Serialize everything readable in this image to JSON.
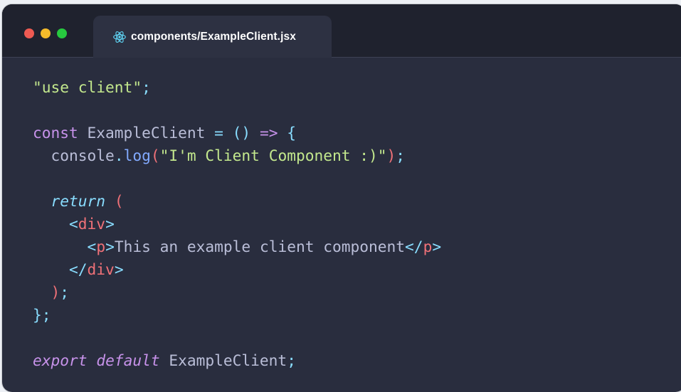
{
  "window": {
    "controls": [
      "close",
      "minimize",
      "maximize"
    ]
  },
  "tab": {
    "icon": "react-icon",
    "label": "components/ExampleClient.jsx"
  },
  "colors": {
    "background": "#292d3e",
    "titlebar": "#1f222e",
    "tab": "#2d3142",
    "plain": "#babed8",
    "string": "#c3e88d",
    "keyword": "#c792ea",
    "operator": "#89ddff",
    "function": "#82aaff",
    "tag": "#f07178",
    "react": "#61dafb"
  },
  "code": {
    "language": "jsx",
    "lines": [
      [
        {
          "t": "\"use client\"",
          "c": "string"
        },
        {
          "t": ";",
          "c": "operator"
        }
      ],
      [],
      [
        {
          "t": "const",
          "c": "keyword"
        },
        {
          "t": " ExampleClient ",
          "c": "plain"
        },
        {
          "t": "=",
          "c": "operator"
        },
        {
          "t": " ",
          "c": "plain"
        },
        {
          "t": "()",
          "c": "operator"
        },
        {
          "t": " ",
          "c": "plain"
        },
        {
          "t": "=>",
          "c": "keyword"
        },
        {
          "t": " ",
          "c": "plain"
        },
        {
          "t": "{",
          "c": "operator"
        }
      ],
      [
        {
          "t": "  console",
          "c": "plain"
        },
        {
          "t": ".",
          "c": "operator"
        },
        {
          "t": "log",
          "c": "function"
        },
        {
          "t": "(",
          "c": "tag"
        },
        {
          "t": "\"I'm Client Component :)\"",
          "c": "string"
        },
        {
          "t": ")",
          "c": "tag"
        },
        {
          "t": ";",
          "c": "operator"
        }
      ],
      [],
      [
        {
          "t": "  ",
          "c": "plain"
        },
        {
          "t": "return",
          "c": "keyword-italic"
        },
        {
          "t": " ",
          "c": "plain"
        },
        {
          "t": "(",
          "c": "tag"
        }
      ],
      [
        {
          "t": "    ",
          "c": "plain"
        },
        {
          "t": "<",
          "c": "operator"
        },
        {
          "t": "div",
          "c": "tag"
        },
        {
          "t": ">",
          "c": "operator"
        }
      ],
      [
        {
          "t": "      ",
          "c": "plain"
        },
        {
          "t": "<",
          "c": "operator"
        },
        {
          "t": "p",
          "c": "tag"
        },
        {
          "t": ">",
          "c": "operator"
        },
        {
          "t": "This an example client component",
          "c": "plain"
        },
        {
          "t": "</",
          "c": "operator"
        },
        {
          "t": "p",
          "c": "tag"
        },
        {
          "t": ">",
          "c": "operator"
        }
      ],
      [
        {
          "t": "    ",
          "c": "plain"
        },
        {
          "t": "</",
          "c": "operator"
        },
        {
          "t": "div",
          "c": "tag"
        },
        {
          "t": ">",
          "c": "operator"
        }
      ],
      [
        {
          "t": "  ",
          "c": "plain"
        },
        {
          "t": ")",
          "c": "tag"
        },
        {
          "t": ";",
          "c": "operator"
        }
      ],
      [
        {
          "t": "}",
          "c": "operator"
        },
        {
          "t": ";",
          "c": "operator"
        }
      ],
      [],
      [
        {
          "t": "export",
          "c": "keyword-italic"
        },
        {
          "t": " ",
          "c": "plain"
        },
        {
          "t": "default",
          "c": "keyword-italic"
        },
        {
          "t": " ExampleClient",
          "c": "plain"
        },
        {
          "t": ";",
          "c": "operator"
        }
      ]
    ]
  }
}
